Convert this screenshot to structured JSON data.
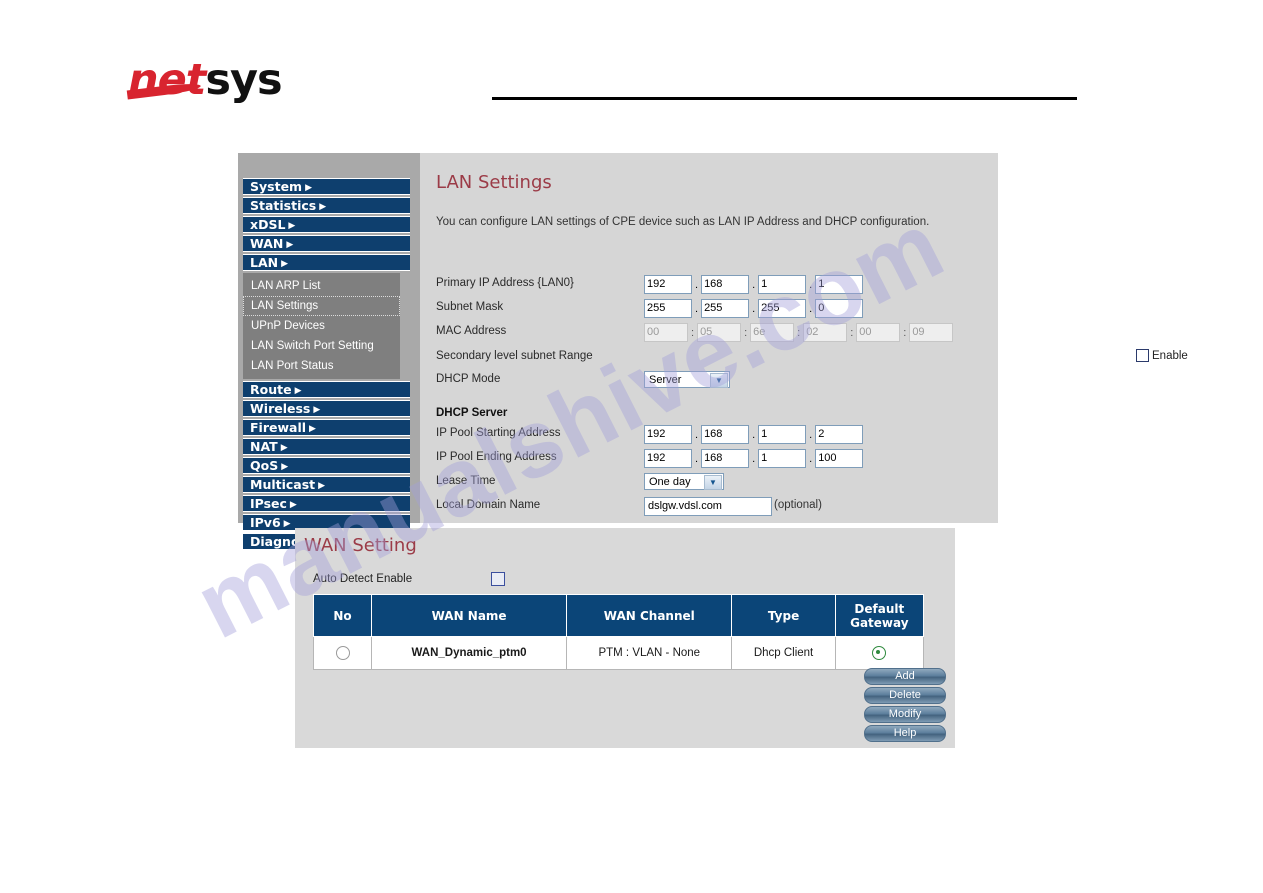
{
  "brand": {
    "logo_first": "net",
    "logo_second": "sys"
  },
  "sidebar": {
    "top_items": [
      {
        "label": "System",
        "caret": "▶"
      },
      {
        "label": "Statistics",
        "caret": "▶"
      },
      {
        "label": "xDSL",
        "caret": "▶"
      },
      {
        "label": "WAN",
        "caret": "▶"
      },
      {
        "label": "LAN",
        "caret": "▶"
      }
    ],
    "sub_items": [
      {
        "label": "LAN ARP List"
      },
      {
        "label": "LAN Settings"
      },
      {
        "label": "UPnP Devices"
      },
      {
        "label": "LAN Switch Port Setting"
      },
      {
        "label": "LAN Port Status"
      }
    ],
    "bottom_items": [
      {
        "label": "Route",
        "caret": "▶"
      },
      {
        "label": "Wireless",
        "caret": "▶"
      },
      {
        "label": "Firewall",
        "caret": "▶"
      },
      {
        "label": "NAT",
        "caret": "▶"
      },
      {
        "label": "QoS",
        "caret": "▶"
      },
      {
        "label": "Multicast",
        "caret": "▶"
      },
      {
        "label": "IPsec",
        "caret": "▶"
      },
      {
        "label": "IPv6",
        "caret": "▶"
      },
      {
        "label": "Diagnostics",
        "caret": "▶"
      }
    ]
  },
  "lan": {
    "title": "LAN Settings",
    "description": "You can configure LAN settings of CPE device such as LAN IP Address and DHCP configuration.",
    "primary_ip": {
      "label": "Primary IP Address {LAN0}",
      "octets": [
        "192",
        "168",
        "1",
        "1"
      ]
    },
    "subnet_mask": {
      "label": "Subnet Mask",
      "octets": [
        "255",
        "255",
        "255",
        "0"
      ]
    },
    "mac_address": {
      "label": "MAC Address",
      "octets": [
        "00",
        "05",
        "6e",
        "02",
        "00",
        "09"
      ]
    },
    "secondary_subnet": {
      "label": "Secondary level subnet Range",
      "enable_label": "Enable",
      "enabled": false
    },
    "dhcp_mode": {
      "label": "DHCP Mode",
      "value": "Server"
    },
    "dhcp_server": {
      "heading": "DHCP Server",
      "pool_start": {
        "label": "IP Pool Starting Address",
        "octets": [
          "192",
          "168",
          "1",
          "2"
        ]
      },
      "pool_end": {
        "label": "IP Pool Ending Address",
        "octets": [
          "192",
          "168",
          "1",
          "100"
        ]
      },
      "lease_time": {
        "label": "Lease Time",
        "value": "One day"
      },
      "local_domain": {
        "label": "Local Domain Name",
        "value": "dslgw.vdsl.com",
        "hint": "(optional)"
      }
    }
  },
  "wan": {
    "title": "WAN Setting",
    "auto_detect": {
      "label": "Auto Detect Enable",
      "checked": false
    },
    "table": {
      "headers": [
        "No",
        "WAN Name",
        "WAN Channel",
        "Type",
        "Default Gateway"
      ],
      "rows": [
        {
          "no_selected": false,
          "name": "WAN_Dynamic_ptm0",
          "channel": "PTM : VLAN - None",
          "type": "Dhcp Client",
          "default_gateway_selected": true
        }
      ]
    },
    "buttons": [
      "Add",
      "Delete",
      "Modify",
      "Help"
    ]
  },
  "watermark": {
    "text": "manualshive.com"
  },
  "colors": {
    "nav_blue": "#0e3f6e",
    "table_header_blue": "#0b4578",
    "title_red": "#9b3b47",
    "logo_red": "#d8242f",
    "sidebar_gray": "#a9a9a9",
    "content_gray": "#d6d6d6"
  }
}
